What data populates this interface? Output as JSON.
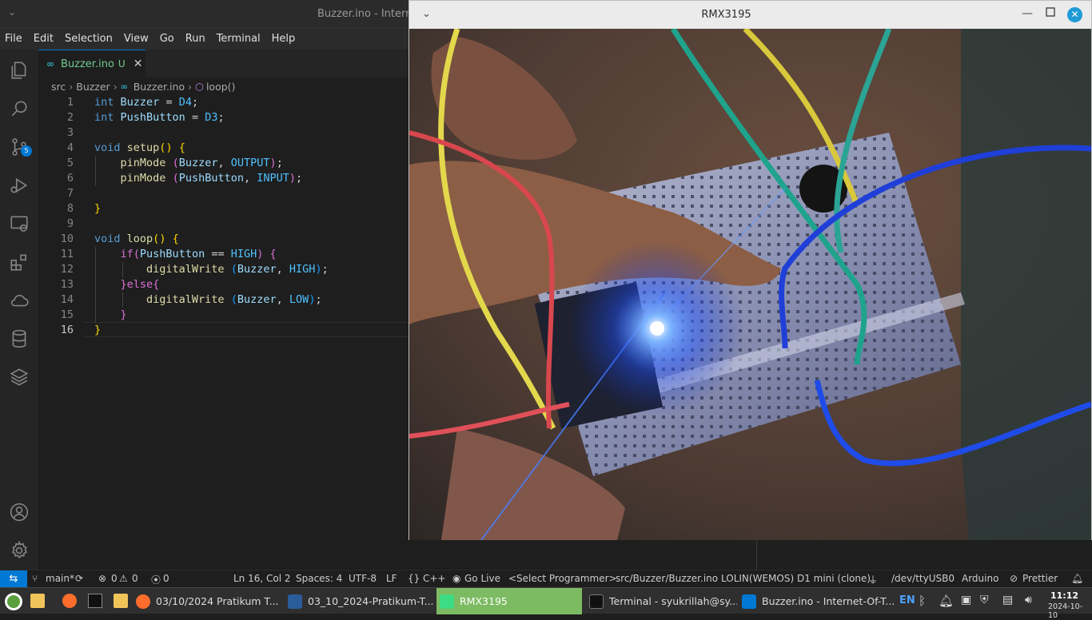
{
  "vscode": {
    "window_title": "Buzzer.ino - Interne",
    "menu": [
      "File",
      "Edit",
      "Selection",
      "View",
      "Go",
      "Run",
      "Terminal",
      "Help"
    ],
    "scm_badge": "5",
    "tab": {
      "label": "Buzzer.ino",
      "status": "U",
      "close": "✕"
    },
    "breadcrumb": [
      "src",
      "Buzzer",
      "Buzzer.ino",
      "loop()"
    ],
    "line_numbers": [
      "1",
      "2",
      "3",
      "4",
      "5",
      "6",
      "7",
      "8",
      "9",
      "10",
      "11",
      "12",
      "13",
      "14",
      "15",
      "16"
    ],
    "code_lines": [
      "int Buzzer = D4;",
      "int PushButton = D3;",
      "",
      "void setup() {",
      "    pinMode (Buzzer, OUTPUT);",
      "    pinMode (PushButton, INPUT);",
      "",
      "}",
      "",
      "void loop() {",
      "    if(PushButton == HIGH) {",
      "        digitalWrite (Buzzer, HIGH);",
      "    }else{",
      "        digitalWrite (Buzzer, LOW);",
      "    }",
      "}"
    ]
  },
  "camera_window": {
    "title": "RMX3195"
  },
  "statusbar": {
    "branch": "main*",
    "errors": "0",
    "warnings": "0",
    "ports": "0",
    "position": "Ln 16, Col 2",
    "spaces": "Spaces: 4",
    "encoding": "UTF-8",
    "eol": "LF",
    "language": "C++",
    "golive": "Go Live",
    "programmer": "<Select Programmer>",
    "sketch": "src/Buzzer/Buzzer.ino",
    "board": "LOLIN(WEMOS) D1 mini (clone)",
    "port": "/dev/ttyUSB0",
    "arduino": "Arduino",
    "prettier": "Prettier"
  },
  "taskbar": {
    "apps": [
      "03/10/2024 Pratikum T...",
      "03_10_2024-Pratikum-T...",
      "RMX3195",
      "Terminal - syukrillah@sy...",
      "Buzzer.ino - Internet-Of-T..."
    ],
    "lang": "EN",
    "time": "11:12",
    "date": "2024-10-10"
  },
  "colors": {
    "accent": "#0078d4",
    "taskbar_active": "#7dbb62",
    "close_button": "#1e9bd7"
  }
}
